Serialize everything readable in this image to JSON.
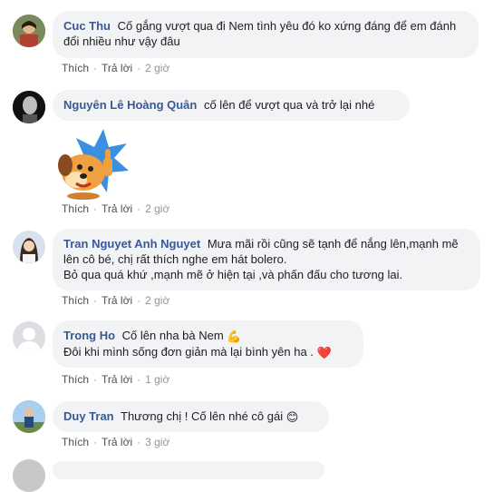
{
  "comments": [
    {
      "author": "Cuc Thu",
      "text": "Cố gắng vượt qua đi Nem tình yêu đó ko xứng đáng để em đánh đổi nhiều như vậy đâu",
      "like": "Thích",
      "reply": "Trả lời",
      "time": "2 giờ"
    },
    {
      "author": "Nguyên Lê Hoàng Quân",
      "text": "cố lên để vượt qua và trở lại nhé",
      "like": "Thích",
      "reply": "Trả lời",
      "time": "2 giờ",
      "sticker": "puppy-thumbs-up-sticker"
    },
    {
      "author": "Tran Nguyet Anh Nguyet",
      "text_line1": "Mưa mãi rồi cũng sẽ tạnh để nắng lên,mạnh mẽ lên cô bé, chị rất thích nghe em hát bolero.",
      "text_line2": "Bỏ qua quá khứ ,mạnh mẽ ở hiện tại ,và phấn đấu cho tương lai.",
      "like": "Thích",
      "reply": "Trả lời",
      "time": "2 giờ"
    },
    {
      "author": "Trong Ho",
      "text_line1": "Cố lên nha bà Nem",
      "text_line2": "Đôi khi mình sống đơn giản mà lại bình yên ha .",
      "like": "Thích",
      "reply": "Trả lời",
      "time": "1 giờ",
      "emoji1": "💪",
      "emoji2": "❤️"
    },
    {
      "author": "Duy Tran",
      "text": "Thương chị ! Cố lên nhé cô gái",
      "like": "Thích",
      "reply": "Trả lời",
      "time": "3 giờ",
      "emoji": "😊"
    }
  ],
  "colors": {
    "author": "#385898",
    "bubble": "#f2f3f5",
    "action": "#4b4f56"
  }
}
